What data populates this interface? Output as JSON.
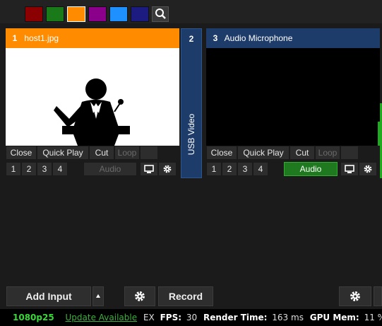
{
  "palette": {
    "swatches": [
      "#8b0000",
      "#1a7a1a",
      "#ff8c00",
      "#8b008b",
      "#1e90ff",
      "#1c1c80"
    ],
    "selected_index": 2,
    "search_icon": "search-icon"
  },
  "inputs": [
    {
      "number": "1",
      "title": "host1.jpg",
      "header_color": "#ff8c00",
      "buttons": {
        "close": "Close",
        "quick_play": "Quick Play",
        "cut": "Cut",
        "loop": "Loop"
      },
      "overlays": [
        "1",
        "2",
        "3",
        "4"
      ],
      "audio": "Audio",
      "audio_on": false
    },
    {
      "number": "2",
      "title": "USB Video",
      "header_color": "#1e3c6a"
    },
    {
      "number": "3",
      "title": "Audio Microphone",
      "header_color": "#1e3c6a",
      "buttons": {
        "close": "Close",
        "quick_play": "Quick Play",
        "cut": "Cut",
        "loop": "Loop"
      },
      "overlays": [
        "1",
        "2",
        "3",
        "4"
      ],
      "audio": "Audio",
      "audio_on": true
    }
  ],
  "bottom": {
    "add_input": "Add Input",
    "record": "Record"
  },
  "status": {
    "resolution": "1080p25",
    "update": "Update Available",
    "ex": "EX",
    "fps_label": "FPS:",
    "fps_value": "30",
    "render_label": "Render Time:",
    "render_value": "163 ms",
    "gpu_label": "GPU Mem:",
    "gpu_value": "11 %"
  },
  "colors": {
    "status_green": "#38d838",
    "update_link": "#3cae3c",
    "audio_active": "#1f7a1f"
  }
}
